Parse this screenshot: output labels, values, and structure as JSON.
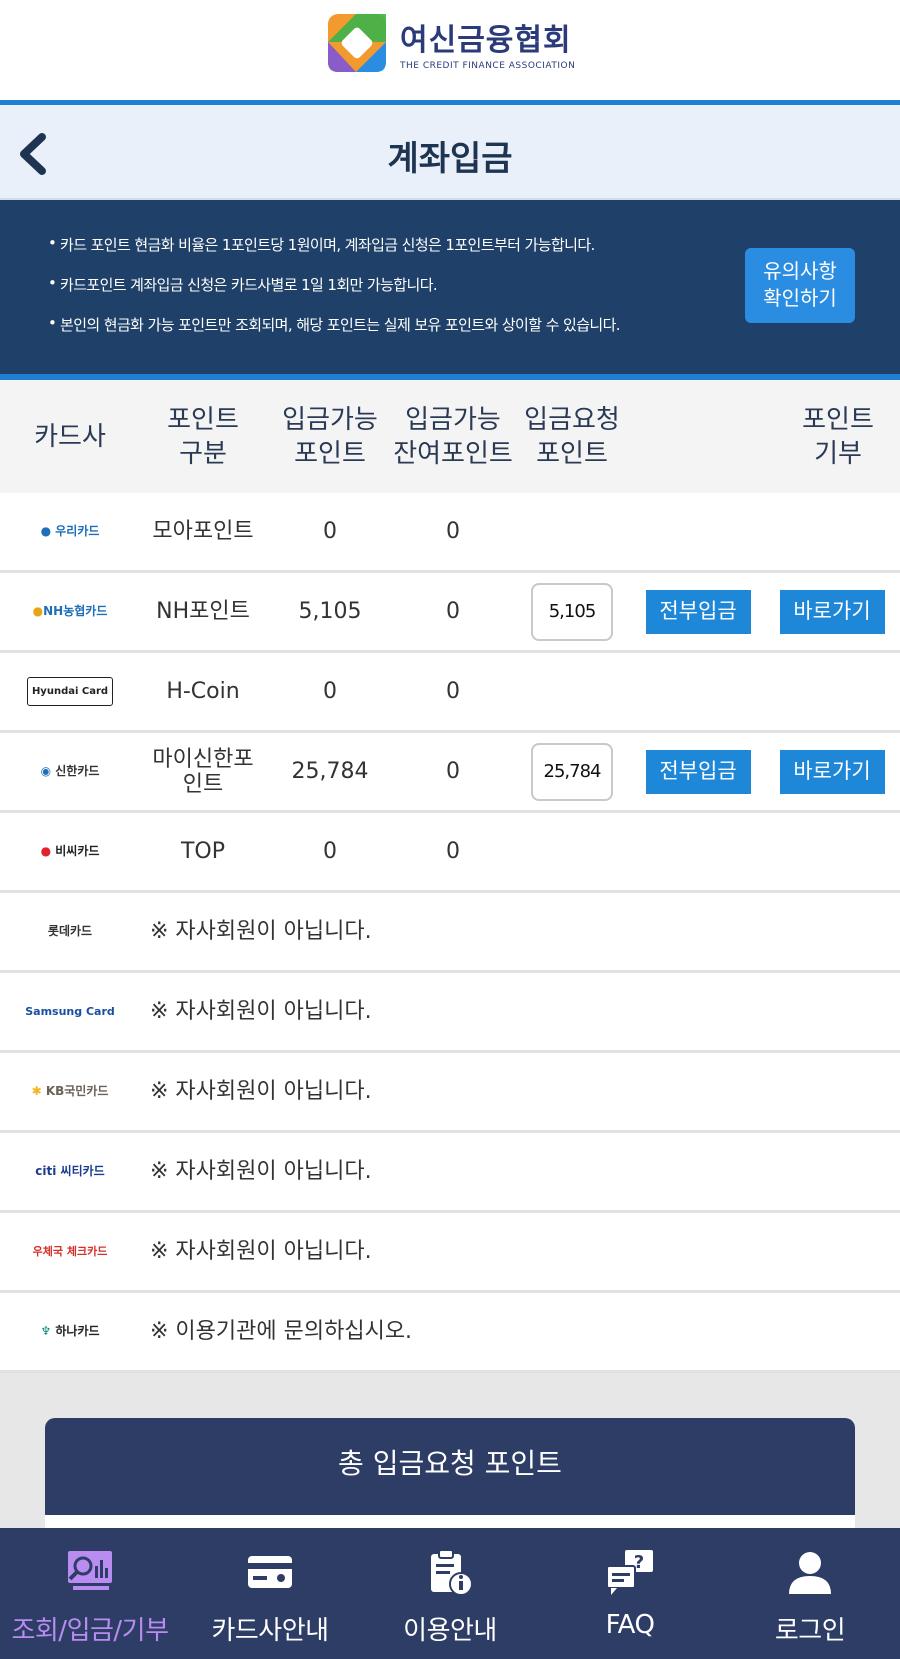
{
  "header": {
    "org_name": "여신금융협회",
    "org_sub": "THE CREDIT FINANCE ASSOCIATION",
    "page_title": "계좌입금"
  },
  "notice": {
    "items": [
      "카드 포인트 현금화 비율은 1포인트당 1원이며, 계좌입금 신청은 1포인트부터 가능합니다.",
      "카드포인트 계좌입금 신청은 카드사별로 1일 1회만 가능합니다.",
      "본인의 현금화 가능 포인트만 조회되며, 해당 포인트는 실제 보유 포인트와 상이할 수 있습니다."
    ],
    "button_label": "유의사항\n확인하기"
  },
  "table": {
    "headers": {
      "company": "카드사",
      "type": "포인트\n구분",
      "available": "입금가능\n포인트",
      "remaining": "입금가능\n잔여포인트",
      "request": "입금요청\n포인트",
      "donate": "포인트\n기부"
    },
    "rows": [
      {
        "logo": "우리카드",
        "type": "모아포인트",
        "available": "0",
        "remaining": "0"
      },
      {
        "logo": "NH농협카드",
        "type": "NH포인트",
        "available": "5,105",
        "remaining": "0",
        "request": "5,105",
        "all_label": "전부입금",
        "go_label": "바로가기"
      },
      {
        "logo": "Hyundai Card",
        "type": "H-Coin",
        "available": "0",
        "remaining": "0"
      },
      {
        "logo": "신한카드",
        "type": "마이신한포\n인트",
        "available": "25,784",
        "remaining": "0",
        "request": "25,784",
        "all_label": "전부입금",
        "go_label": "바로가기"
      },
      {
        "logo": "비씨카드",
        "type": "TOP",
        "available": "0",
        "remaining": "0"
      },
      {
        "logo": "롯데카드",
        "message": "※ 자사회원이 아닙니다."
      },
      {
        "logo": "Samsung Card",
        "message": "※ 자사회원이 아닙니다."
      },
      {
        "logo": "KB국민카드",
        "message": "※ 자사회원이 아닙니다."
      },
      {
        "logo": "citi 씨티카드",
        "message": "※ 자사회원이 아닙니다."
      },
      {
        "logo": "우체국 체크카드",
        "message": "※ 자사회원이 아닙니다."
      },
      {
        "logo": "하나카드",
        "message": "※ 이용기관에 문의하십시오."
      }
    ]
  },
  "summary": {
    "title": "총 입금요청 포인트"
  },
  "nav": {
    "items": [
      {
        "label": "조회/입금/기부",
        "icon": "search-chart-icon",
        "active": true
      },
      {
        "label": "카드사안내",
        "icon": "card-icon",
        "active": false
      },
      {
        "label": "이용안내",
        "icon": "clipboard-info-icon",
        "active": false
      },
      {
        "label": "FAQ",
        "icon": "faq-chat-icon",
        "active": false
      },
      {
        "label": "로그인",
        "icon": "user-icon",
        "active": false
      }
    ]
  },
  "colors": {
    "accent": "#1f87d8",
    "navy": "#1f4068",
    "nav_bg": "#2e3d66",
    "active_nav": "#b88cf0"
  }
}
